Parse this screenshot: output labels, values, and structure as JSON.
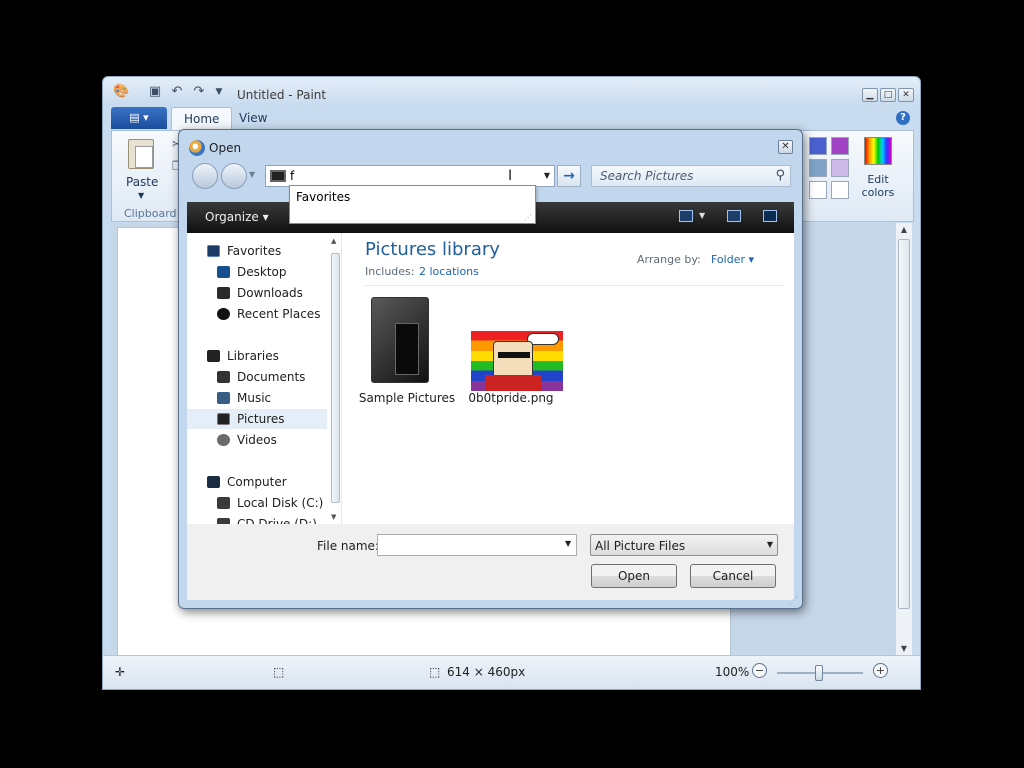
{
  "paint": {
    "title": "Untitled - Paint",
    "tabs": [
      {
        "label": "Home"
      },
      {
        "label": "View"
      }
    ],
    "ribbon": {
      "paste_label": "Paste",
      "clipboard_group": "Clipboard",
      "edit_colors_label": "Edit\ncolors",
      "palette_colors": [
        "#4b5fd1",
        "#a242c4",
        "#7fa3c7",
        "#cfb8ea",
        "#ffffff",
        "#ffffff"
      ]
    },
    "status": {
      "dimensions": "614 × 460px",
      "zoom": "100%"
    }
  },
  "dialog": {
    "title": "Open",
    "address_text": "f",
    "autocomplete": [
      "Favorites"
    ],
    "search_placeholder": "Search Pictures",
    "toolbar": {
      "organize": "Organize"
    },
    "nav": [
      {
        "label": "Favorites",
        "icon": "star-icon"
      },
      {
        "label": "Desktop",
        "icon": "desktop-icon"
      },
      {
        "label": "Downloads",
        "icon": "downloads-icon"
      },
      {
        "label": "Recent Places",
        "icon": "recent-places-icon"
      },
      {
        "label": "Libraries",
        "icon": "library-icon"
      },
      {
        "label": "Documents",
        "icon": "documents-icon"
      },
      {
        "label": "Music",
        "icon": "music-icon"
      },
      {
        "label": "Pictures",
        "icon": "pictures-icon"
      },
      {
        "label": "Videos",
        "icon": "videos-icon"
      },
      {
        "label": "Computer",
        "icon": "computer-icon"
      },
      {
        "label": "Local Disk (C:)",
        "icon": "disk-icon"
      },
      {
        "label": "CD Drive (D:)",
        "icon": "cd-icon"
      }
    ],
    "library": {
      "title": "Pictures library",
      "includes_label": "Includes:",
      "includes_link": "2 locations",
      "arrange_label": "Arrange by:",
      "arrange_value": "Folder"
    },
    "files": [
      {
        "name": "Sample Pictures",
        "type": "folder"
      },
      {
        "name": "0b0tpride.png",
        "type": "image"
      }
    ],
    "filename_label": "File name:",
    "filename_value": "",
    "filetype": "All Picture Files",
    "open_label": "Open",
    "cancel_label": "Cancel"
  }
}
